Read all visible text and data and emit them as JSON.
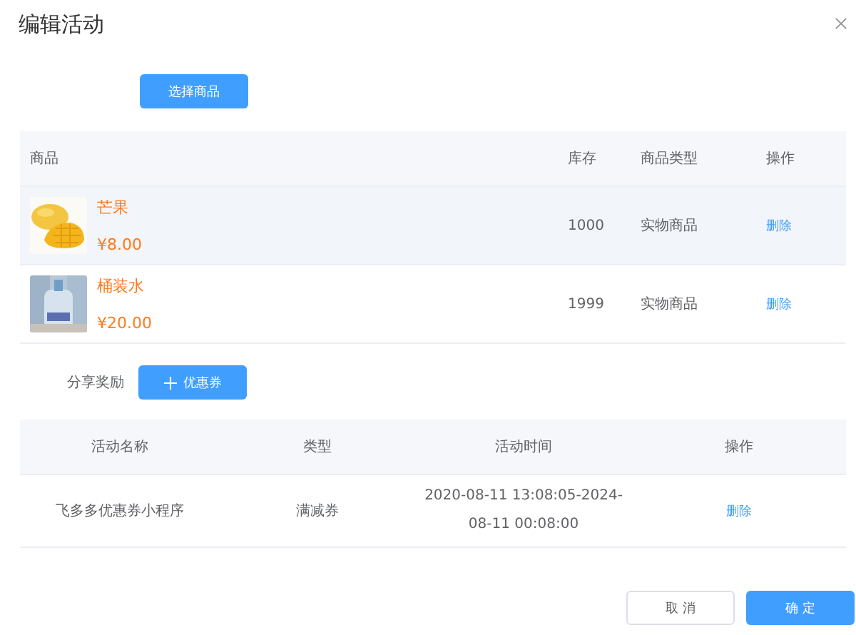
{
  "dialog": {
    "title": "编辑活动"
  },
  "select_button": "选择商品",
  "goods_table": {
    "columns": [
      "商品",
      "库存",
      "商品类型",
      "操作"
    ],
    "rows": [
      {
        "name": "芒果",
        "price": "¥8.00",
        "stock": "1000",
        "type": "实物商品",
        "action": "删除",
        "highlighted": true
      },
      {
        "name": "桶装水",
        "price": "¥20.00",
        "stock": "1999",
        "type": "实物商品",
        "action": "删除",
        "highlighted": false
      }
    ]
  },
  "share_reward": {
    "label": "分享奖励",
    "button": "优惠券"
  },
  "coupon_table": {
    "columns": [
      "活动名称",
      "类型",
      "活动时间",
      "操作"
    ],
    "rows": [
      {
        "name": "飞多多优惠券小程序",
        "type": "满减券",
        "time": "2020-08-11 13:08:05-2024-08-11 00:08:00",
        "action": "删除"
      }
    ]
  },
  "footer": {
    "cancel": "取 消",
    "confirm": "确 定"
  }
}
